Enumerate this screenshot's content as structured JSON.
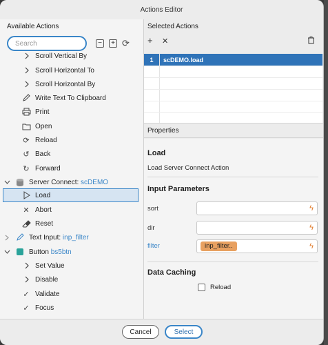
{
  "window": {
    "title": "Actions Editor"
  },
  "left": {
    "header": "Available Actions",
    "search": {
      "placeholder": "Search",
      "value": ""
    },
    "tree": [
      {
        "label": "Scroll Vertical By",
        "icon": "chevron-right-icon"
      },
      {
        "label": "Scroll Horizontal To",
        "icon": "chevron-right-icon"
      },
      {
        "label": "Scroll Horizontal By",
        "icon": "chevron-right-icon"
      },
      {
        "label": "Write Text To Clipboard",
        "icon": "pencil-icon"
      },
      {
        "label": "Print",
        "icon": "printer-icon"
      },
      {
        "label": "Open",
        "icon": "folder-icon"
      },
      {
        "label": "Reload",
        "icon": "reload-icon"
      },
      {
        "label": "Back",
        "icon": "back-icon"
      },
      {
        "label": "Forward",
        "icon": "forward-icon"
      },
      {
        "label": "Server Connect: ",
        "sub": "scDEMO",
        "icon": "database-icon"
      },
      {
        "label": "Load",
        "icon": "play-icon"
      },
      {
        "label": "Abort",
        "icon": "close-icon"
      },
      {
        "label": "Reset",
        "icon": "eraser-icon"
      },
      {
        "label": "Text Input: ",
        "sub": "inp_filter",
        "icon": "pencil-icon"
      },
      {
        "label": "Button ",
        "sub": "bs5btn",
        "icon": "button-icon"
      },
      {
        "label": "Set Value",
        "icon": "chevron-right-icon"
      },
      {
        "label": "Disable",
        "icon": "chevron-right-icon"
      },
      {
        "label": "Validate",
        "icon": "check-icon"
      },
      {
        "label": "Focus",
        "icon": "check-icon"
      }
    ]
  },
  "right": {
    "selected_header": "Selected Actions",
    "selected": [
      {
        "num": "1",
        "label": "scDEMO.load"
      }
    ],
    "properties_header": "Properties",
    "props": {
      "title": "Load",
      "desc": "Load Server Connect Action",
      "input_params_title": "Input Parameters",
      "params": [
        {
          "label": "sort",
          "value": ""
        },
        {
          "label": "dir",
          "value": ""
        },
        {
          "label": "filter",
          "value": "inp_filter.."
        }
      ],
      "caching_title": "Data Caching",
      "reload_label": "Reload",
      "reload_checked": false
    }
  },
  "footer": {
    "cancel": "Cancel",
    "select": "Select"
  },
  "colors": {
    "accent": "#3a86c8",
    "selection": "#2f73b8",
    "chip": "#e8a060",
    "bolt": "#e07a2a"
  }
}
